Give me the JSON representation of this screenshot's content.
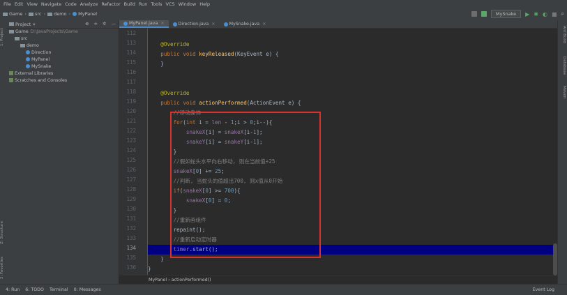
{
  "menu": [
    "File",
    "Edit",
    "View",
    "Navigate",
    "Code",
    "Analyze",
    "Refactor",
    "Build",
    "Run",
    "Tools",
    "VCS",
    "Window",
    "Help"
  ],
  "breadcrumb": [
    "Game",
    "src",
    "demo",
    "MyPanel"
  ],
  "run_config": "MySnake",
  "project": {
    "header": "Project",
    "tree": [
      {
        "label": "Game",
        "path": "D:\\JavaProjects\\Game",
        "indent": 0,
        "type": "folder"
      },
      {
        "label": "src",
        "indent": 1,
        "type": "folder"
      },
      {
        "label": "demo",
        "indent": 2,
        "type": "folder"
      },
      {
        "label": "Direction",
        "indent": 3,
        "type": "class"
      },
      {
        "label": "MyPanel",
        "indent": 3,
        "type": "class"
      },
      {
        "label": "MySnake",
        "indent": 3,
        "type": "class"
      },
      {
        "label": "External Libraries",
        "indent": 0,
        "type": "lib"
      },
      {
        "label": "Scratches and Consoles",
        "indent": 0,
        "type": "lib"
      }
    ]
  },
  "tabs": [
    "MyPanel.java",
    "Direction.java",
    "MySnake.java"
  ],
  "left_tabs": [
    "1: Project",
    "Z: Structure",
    "2: Favorites"
  ],
  "right_tabs": [
    "Ant Build",
    "Database",
    "Maven"
  ],
  "code": {
    "lines": [
      {
        "n": "112",
        "t": ""
      },
      {
        "n": "113",
        "t": "    @Override"
      },
      {
        "n": "114",
        "t": "    public void keyReleased(KeyEvent e) {"
      },
      {
        "n": "115",
        "t": "    }"
      },
      {
        "n": "116",
        "t": ""
      },
      {
        "n": "117",
        "t": ""
      },
      {
        "n": "118",
        "t": "    @Override"
      },
      {
        "n": "119",
        "t": "    public void actionPerformed(ActionEvent e) {"
      },
      {
        "n": "120",
        "t": "        //移动身体"
      },
      {
        "n": "121",
        "t": "        for(int i = len - 1;i > 0;i--){"
      },
      {
        "n": "122",
        "t": "            snakeX[i] = snakeX[i-1];"
      },
      {
        "n": "123",
        "t": "            snakeY[i] = snakeY[i-1];"
      },
      {
        "n": "124",
        "t": "        }"
      },
      {
        "n": "125",
        "t": "        //假如蛇头水平向右移动, 则在当前值+25"
      },
      {
        "n": "126",
        "t": "        snakeX[0] += 25;"
      },
      {
        "n": "127",
        "t": "        //判断, 当蛇头的值超出700, 则x值从0开始"
      },
      {
        "n": "128",
        "t": "        if(snakeX[0] >= 700){"
      },
      {
        "n": "129",
        "t": "            snakeX[0] = 0;"
      },
      {
        "n": "130",
        "t": "        }"
      },
      {
        "n": "131",
        "t": "        //重新画组件"
      },
      {
        "n": "132",
        "t": "        repaint();"
      },
      {
        "n": "133",
        "t": "        //重新启动定时器"
      },
      {
        "n": "134",
        "t": "        timer.start();"
      },
      {
        "n": "135",
        "t": "    }"
      },
      {
        "n": "136",
        "t": "}"
      }
    ],
    "current_line": "134"
  },
  "editor_breadcrumb": "MyPanel › actionPerformed()",
  "status": {
    "items": [
      "4: Run",
      "6: TODO",
      "Terminal",
      "0: Messages"
    ],
    "event_log": "Event Log"
  },
  "colors": {
    "highlight_box": "#d9312b",
    "caret_line": "#000080",
    "keyword": "#cc7832",
    "annotation": "#bbb529",
    "method": "#ffc66d",
    "number": "#6897bb",
    "comment": "#808080",
    "field": "#9876aa"
  }
}
